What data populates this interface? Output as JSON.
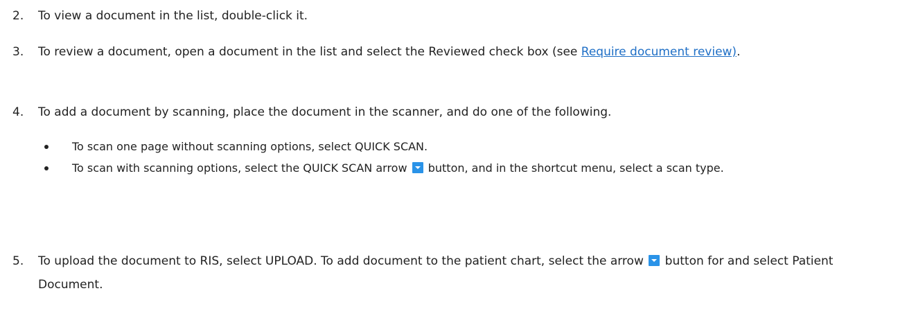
{
  "steps": [
    {
      "num": "2.",
      "text": "To view a document in the list, double-click it."
    },
    {
      "num": "3.",
      "text_before": "To review a document, open a document in the list and select the Reviewed check box (see ",
      "link": "Require document review)",
      "text_after": "."
    },
    {
      "num": "4.",
      "text": "To add a document by scanning, place the document in the scanner, and do one of the following."
    },
    {
      "num": "5.",
      "text_before": "To upload the document to RIS, select UPLOAD. To add document to the patient chart, select the arrow",
      "text_after": " button for and select Patient Document."
    }
  ],
  "bullets": [
    {
      "text": "To scan one page without scanning options, select QUICK SCAN."
    },
    {
      "text_before": "To scan with scanning options, select the QUICK SCAN arrow",
      "text_after": " button, and in the shortcut menu, select a scan type."
    }
  ],
  "icons": {
    "arrow_button": "dropdown-arrow-icon",
    "color": "#2a93e8"
  }
}
